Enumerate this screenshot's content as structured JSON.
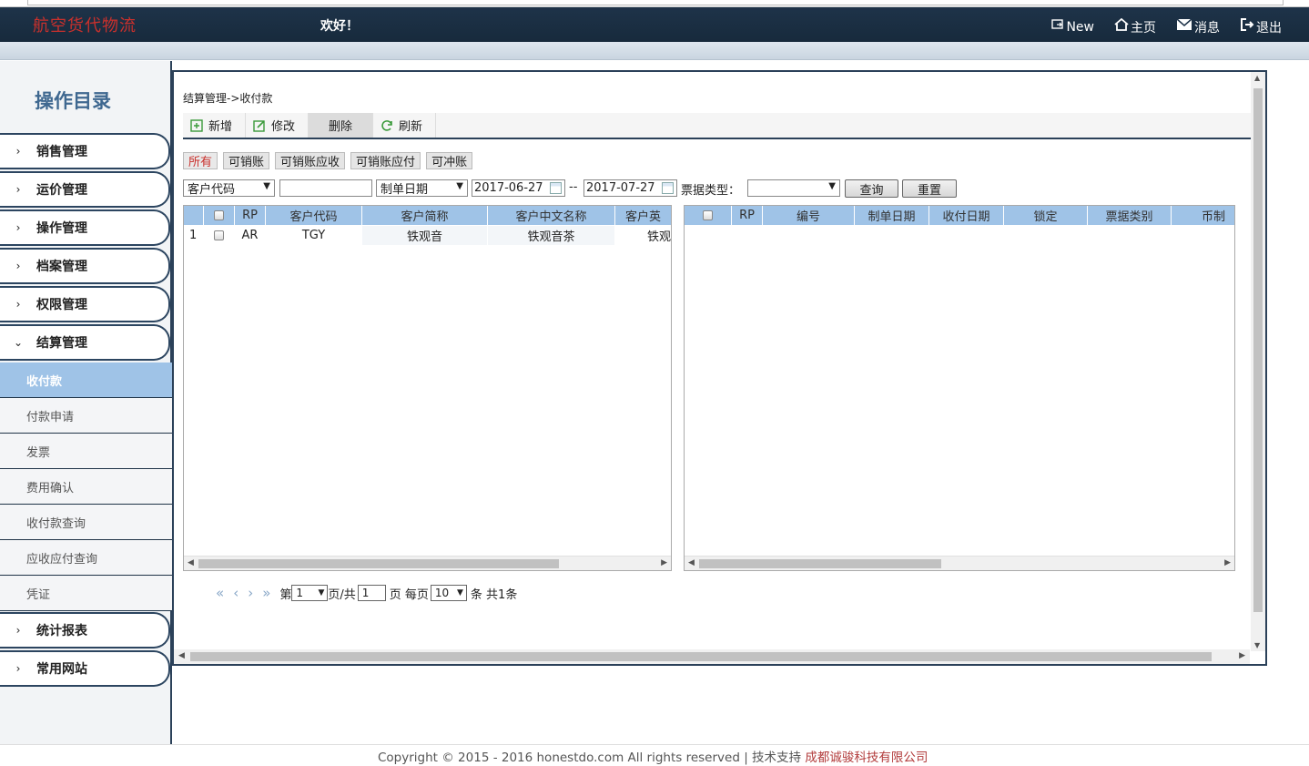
{
  "header": {
    "logo": "航空货代物流",
    "greeting": "欢好！",
    "nav": [
      {
        "label": "New",
        "icon": "new-window-icon"
      },
      {
        "label": "主页",
        "icon": "home-icon"
      },
      {
        "label": "消息",
        "icon": "mail-icon"
      },
      {
        "label": "退出",
        "icon": "logout-icon"
      }
    ]
  },
  "sidebar": {
    "title": "操作目录",
    "groups": [
      "销售管理",
      "运价管理",
      "操作管理",
      "档案管理",
      "权限管理",
      "结算管理",
      "统计报表",
      "常用网站"
    ],
    "sub_items": [
      "收付款",
      "付款申请",
      "发票",
      "费用确认",
      "收付款查询",
      "应收应付查询",
      "凭证"
    ],
    "active_sub": "收付款"
  },
  "main": {
    "breadcrumb": "结算管理->收付款",
    "toolbar": {
      "add": "新增",
      "edit": "修改",
      "delete": "删除",
      "refresh": "刷新"
    },
    "filters": [
      "所有",
      "可销账",
      "可销账应收",
      "可销账应付",
      "可冲账"
    ],
    "search": {
      "field_select": "客户代码",
      "field_value": "",
      "date_type": "制单日期",
      "date_from": "2017-06-27",
      "date_sep": "--",
      "date_to": "2017-07-27",
      "bill_type_label": "票据类型：",
      "bill_type_value": "",
      "query_btn": "查询",
      "reset_btn": "重置"
    },
    "left_grid": {
      "columns": [
        "",
        "RP",
        "客户代码",
        "客户简称",
        "客户中文名称",
        "客户英"
      ],
      "rows": [
        {
          "no": "1",
          "rp": "AR",
          "code": "TGY",
          "short": "铁观音",
          "cn_name": "铁观音茶",
          "en": "铁观"
        }
      ]
    },
    "right_grid": {
      "columns": [
        "RP",
        "编号",
        "制单日期",
        "收付日期",
        "锁定",
        "票据类别",
        "币制"
      ]
    },
    "pager": {
      "prefix": "第",
      "page": "1",
      "page_of": "页/共",
      "total_pages": "1",
      "per_page_label": "页 每页",
      "per_page": "10",
      "suffix": "条 共1条"
    }
  },
  "footer": {
    "copyright": "Copyright © 2015 - 2016 honestdo.com All rights reserved | 技术支持 ",
    "company": "成都诚骏科技有限公司"
  },
  "colors": {
    "header_bg": "#1e3349",
    "grid_header": "#9fc3e7",
    "logo_red": "#c9302c",
    "border_dark": "#2b4159"
  }
}
